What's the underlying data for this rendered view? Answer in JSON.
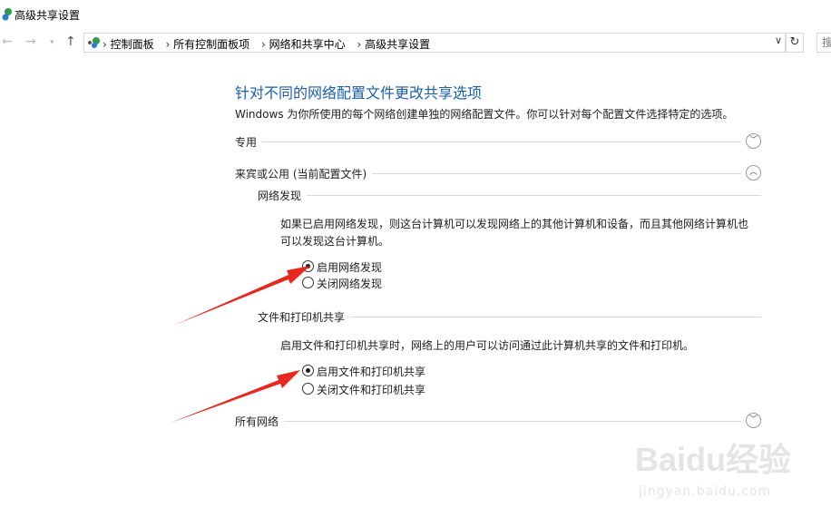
{
  "window": {
    "title": "高级共享设置"
  },
  "nav": {
    "back_icon": "back-arrow-icon",
    "forward_icon": "forward-arrow-icon",
    "recent_icon": "chevron-down-icon",
    "up_icon": "up-arrow-icon",
    "breadcrumbs": [
      "控制面板",
      "所有控制面板项",
      "网络和共享中心",
      "高级共享设置"
    ],
    "separator": "›",
    "search_label": "搜"
  },
  "page": {
    "heading": "针对不同的网络配置文件更改共享选项",
    "description": "Windows 为你所使用的每个网络创建单独的网络配置文件。你可以针对每个配置文件选择特定的选项。",
    "profiles": [
      {
        "label": "专用",
        "expanded": false
      },
      {
        "label": "来宾或公用 (当前配置文件)",
        "expanded": true
      },
      {
        "label": "所有网络",
        "expanded": false
      }
    ],
    "network_discovery": {
      "title": "网络发现",
      "description_line1": "如果已启用网络发现，则这台计算机可以发现网络上的其他计算机和设备，而且其他网络计算机也",
      "description_line2": "可以发现这台计算机。",
      "options": [
        "启用网络发现",
        "关闭网络发现"
      ],
      "selected": 0
    },
    "file_printer_sharing": {
      "title": "文件和打印机共享",
      "description": "启用文件和打印机共享时，网络上的用户可以访问通过此计算机共享的文件和打印机。",
      "options": [
        "启用文件和打印机共享",
        "关闭文件和打印机共享"
      ],
      "selected": 0
    }
  },
  "annotations": {
    "arrow_color": "#e8281e"
  },
  "watermark": {
    "brand": "Baidu经验",
    "url": "jingyan.baidu.com"
  },
  "colors": {
    "heading": "#1c5ea8",
    "divider": "#d8d8d8"
  }
}
